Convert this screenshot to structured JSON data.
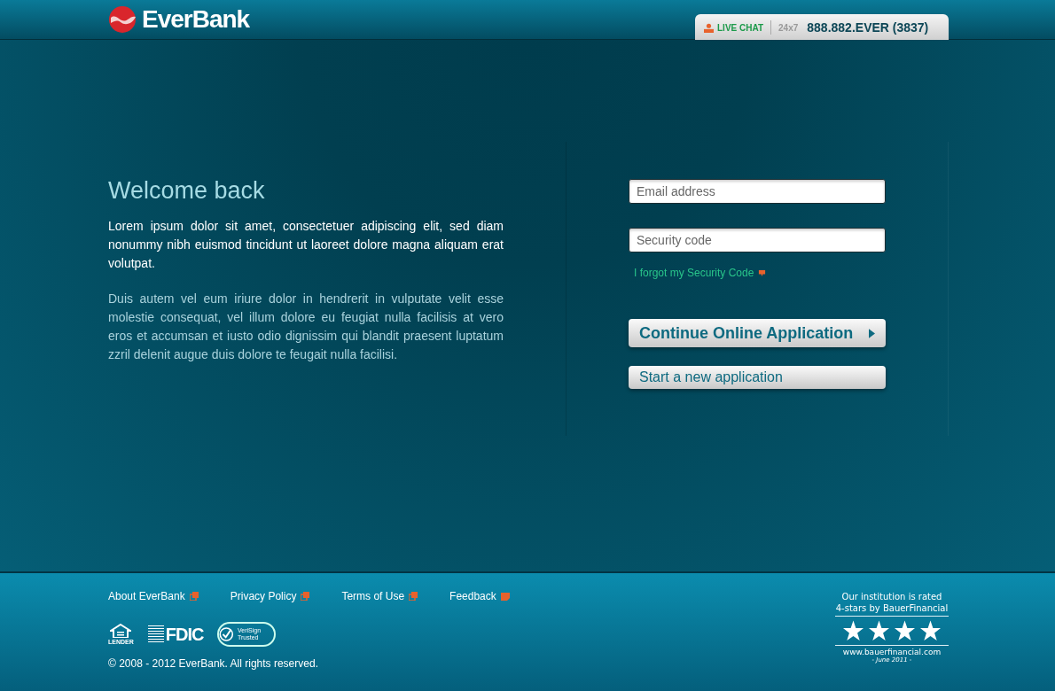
{
  "header": {
    "brand": "EverBank",
    "live_chat": "LIVE CHAT",
    "hours": "24x7",
    "phone": "888.882.EVER (3837)"
  },
  "intro": {
    "title": "Welcome back",
    "lead": "Lorem ipsum dolor sit amet, consectetuer adipiscing elit, sed diam nonummy nibh euismod tincidunt ut laoreet dolore magna aliquam erat volutpat.",
    "body": "Duis autem vel eum iriure dolor in hendrerit in vulputate velit esse molestie consequat, vel illum dolore eu feugiat nulla facilisis at vero eros et accumsan et iusto odio dignissim qui blandit praesent luptatum zzril delenit augue duis dolore te feugait nulla facilisi."
  },
  "login": {
    "email": {
      "placeholder": "Email address"
    },
    "code": {
      "placeholder": "Security code"
    },
    "forgot_link": "I forgot my Security Code",
    "buttons": [
      {
        "label": "Continue Online Application",
        "kind": "primary"
      },
      {
        "label": "Start a new application",
        "kind": "secondary"
      }
    ]
  },
  "footer": {
    "links": [
      {
        "label": "About EverBank",
        "kind": "external"
      },
      {
        "label": "Privacy Policy",
        "kind": "external"
      },
      {
        "label": "Terms of Use",
        "kind": "external"
      },
      {
        "label": "Feedback",
        "kind": "feedback"
      }
    ],
    "badges": [
      {
        "kind": "housing",
        "label": "LENDER"
      },
      {
        "kind": "fdic",
        "label": "FDIC"
      },
      {
        "kind": "verisign",
        "label": "VeriSign Trusted"
      }
    ],
    "copyright": "© 2008 - 2012 EverBank. All rights reserved.",
    "rating": {
      "line1": "Our institution is rated",
      "line2": "4-stars by BauerFinancial",
      "stars": 4,
      "url": "www.bauerfinancial.com",
      "date": "- June 2011 -"
    }
  }
}
